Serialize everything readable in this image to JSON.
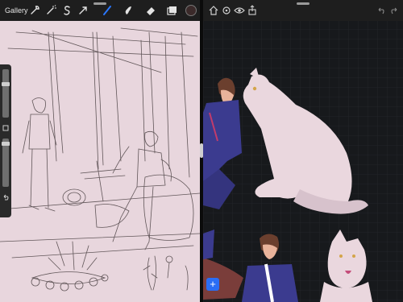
{
  "left_app": {
    "toolbar": {
      "gallery_label": "Gallery",
      "tools": [
        {
          "icon": "wrench-icon"
        },
        {
          "icon": "magic-wand-icon"
        },
        {
          "icon": "selection-s-icon"
        },
        {
          "icon": "transform-arrow-icon"
        },
        {
          "icon": "brush-icon"
        },
        {
          "icon": "smudge-icon"
        },
        {
          "icon": "eraser-icon"
        },
        {
          "icon": "layers-icon"
        },
        {
          "icon": "color-swatch-icon"
        }
      ],
      "active_color": "#3b2a2a",
      "active_tool_color": "#2a78ff"
    },
    "canvas": {
      "background": "#e8d6dd",
      "stroke_color": "#4a4042"
    }
  },
  "right_app": {
    "toolbar": {
      "tools": [
        {
          "icon": "home-icon"
        },
        {
          "icon": "settings-icon"
        },
        {
          "icon": "eye-icon"
        },
        {
          "icon": "share-icon"
        }
      ],
      "undo_icon": "undo-icon",
      "redo_icon": "redo-icon"
    },
    "canvas": {
      "background": "#17191c",
      "grid_color": "#2a2d31"
    },
    "add_button": {
      "icon": "plus-icon",
      "label": "+",
      "color": "#2a6df4"
    }
  }
}
